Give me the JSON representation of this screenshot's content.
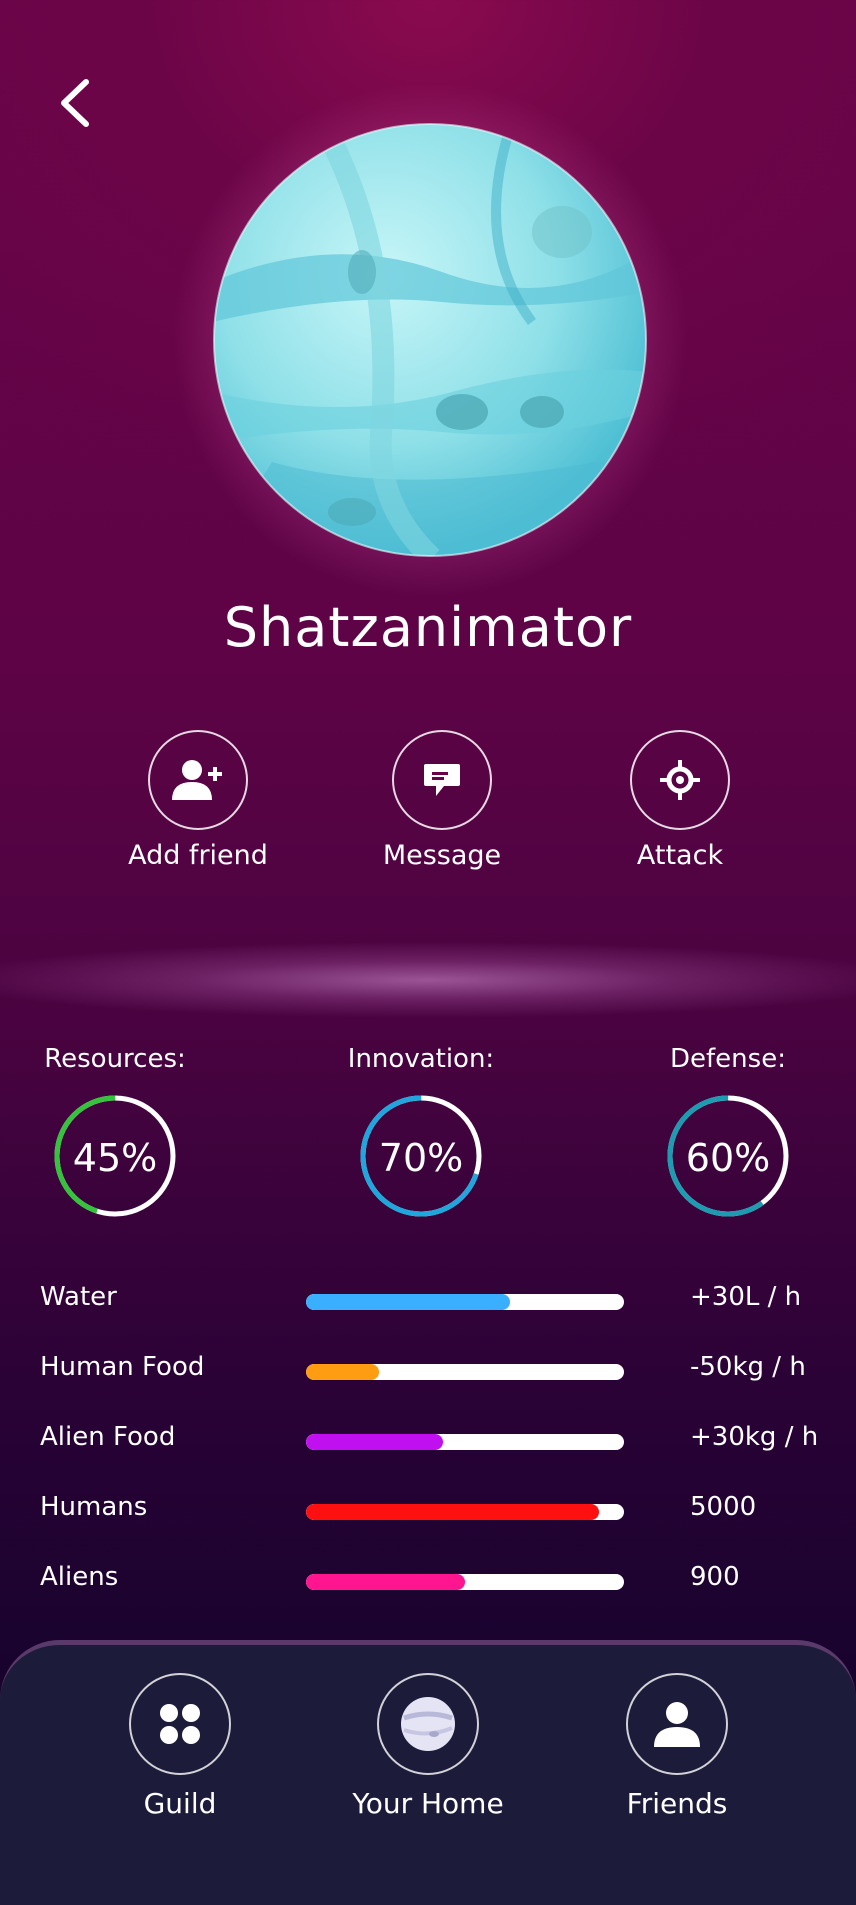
{
  "profile": {
    "name": "Shatzanimator"
  },
  "actions": [
    {
      "label": "Add friend",
      "icon": "add-user-icon"
    },
    {
      "label": "Message",
      "icon": "message-icon"
    },
    {
      "label": "Attack",
      "icon": "crosshair-icon"
    }
  ],
  "stats": [
    {
      "label": "Resources:",
      "percent": "45%",
      "value": 45,
      "color": "#35c23d"
    },
    {
      "label": "Innovation:",
      "percent": "70%",
      "value": 70,
      "color": "#1fa6dc"
    },
    {
      "label": "Defense:",
      "percent": "60%",
      "value": 60,
      "color": "#1d9bb0"
    }
  ],
  "resources": [
    {
      "name": "Water",
      "value": "+30L / h",
      "fill": 64,
      "color": "#3aaeff"
    },
    {
      "name": "Human Food",
      "value": "-50kg / h",
      "fill": 23,
      "color": "#ff9d12"
    },
    {
      "name": "Alien Food",
      "value": "+30kg / h",
      "fill": 43,
      "color": "#c010f0"
    },
    {
      "name": "Humans",
      "value": "5000",
      "fill": 92,
      "color": "#ff1010"
    },
    {
      "name": "Aliens",
      "value": "900",
      "fill": 50,
      "color": "#ff1590"
    }
  ],
  "nav": [
    {
      "label": "Guild",
      "icon": "grid-icon"
    },
    {
      "label": "Your Home",
      "icon": "planet-icon"
    },
    {
      "label": "Friends",
      "icon": "user-icon"
    }
  ]
}
